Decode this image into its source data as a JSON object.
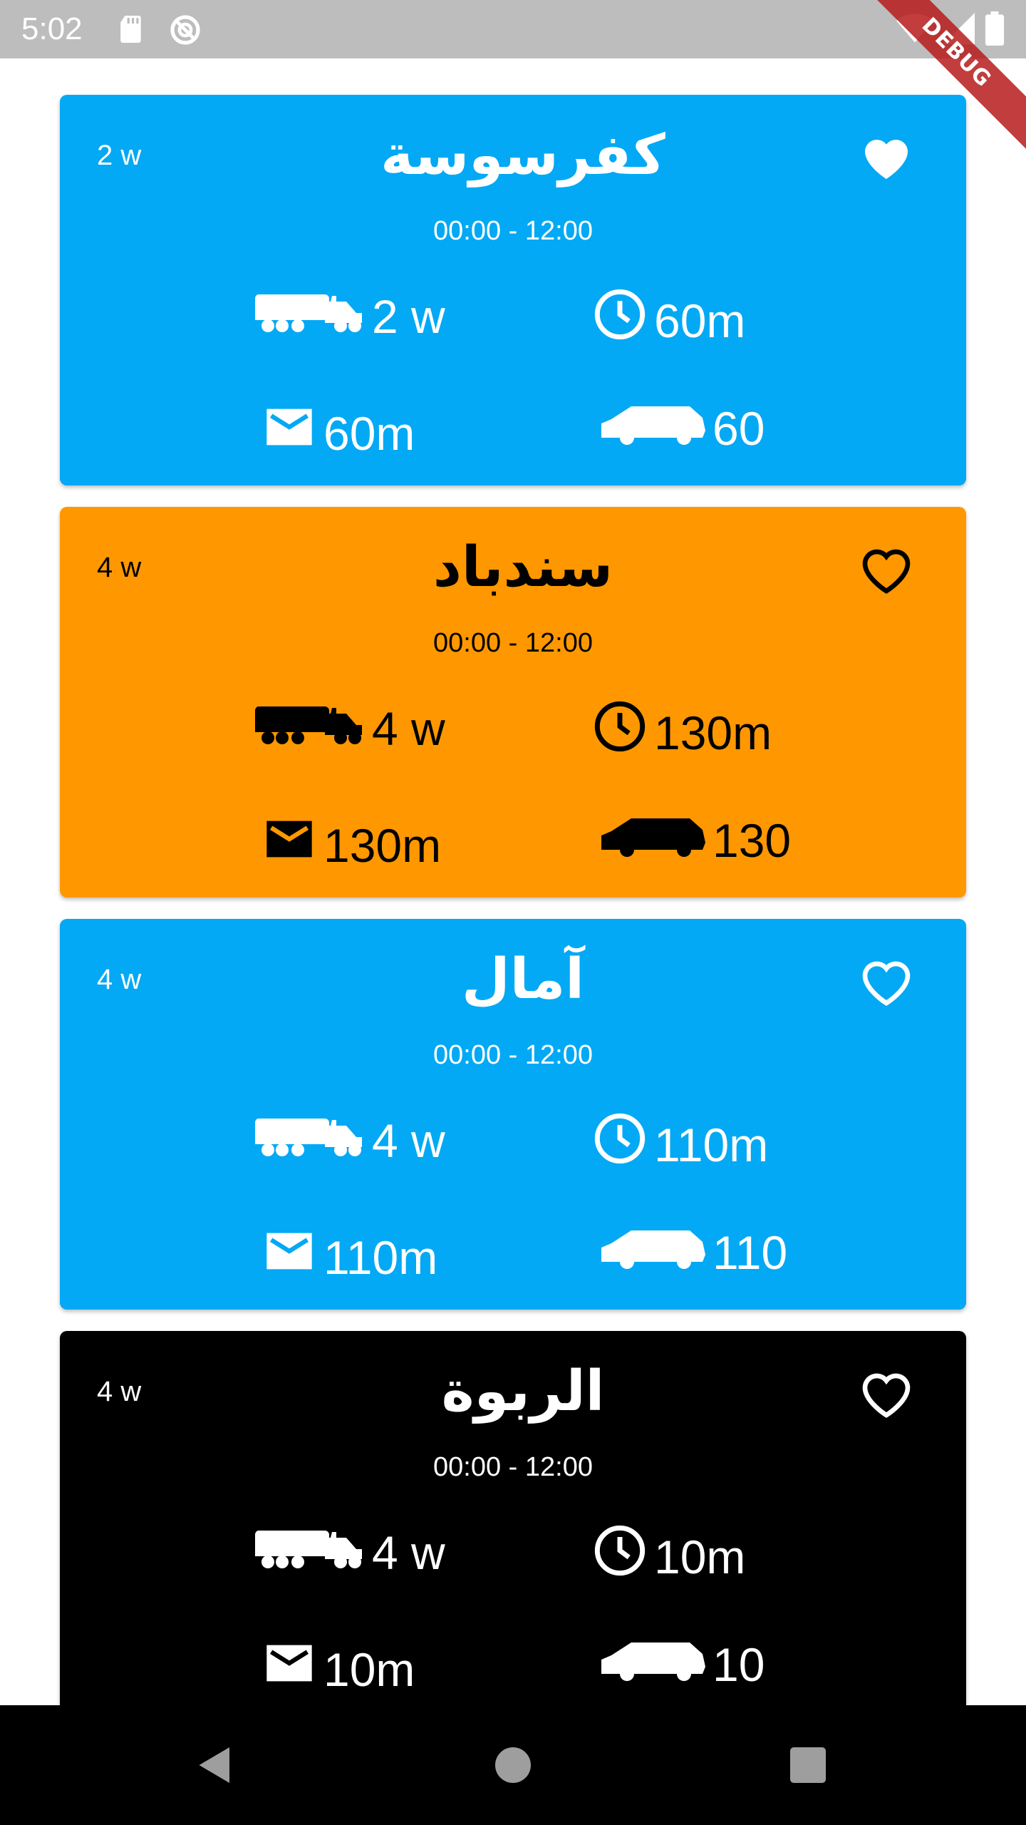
{
  "status_bar": {
    "time": "5:02",
    "icons": [
      "sd-card-icon",
      "sync-icon",
      "wifi-icon",
      "signal-icon",
      "battery-icon"
    ],
    "background": "#bdbdbd"
  },
  "debug_banner": {
    "label": "DEBUG",
    "color": "#b71c1c"
  },
  "cards": [
    {
      "badge": "2 w",
      "title": "كفرسوسة",
      "hours": "00:00 - 12:00",
      "truck_value": "2 w",
      "clock_value": "60m",
      "mail_value": "60m",
      "car_value": "60",
      "favorite": true,
      "background": "#03a9f4",
      "foreground": "#ffffff"
    },
    {
      "badge": "4 w",
      "title": "سندباد",
      "hours": "00:00 - 12:00",
      "truck_value": "4 w",
      "clock_value": "130m",
      "mail_value": "130m",
      "car_value": "130",
      "favorite": false,
      "background": "#ff9800",
      "foreground": "#000000"
    },
    {
      "badge": "4 w",
      "title": "آمال",
      "hours": "00:00 - 12:00",
      "truck_value": "4 w",
      "clock_value": "110m",
      "mail_value": "110m",
      "car_value": "110",
      "favorite": false,
      "background": "#03a9f4",
      "foreground": "#ffffff"
    },
    {
      "badge": "4 w",
      "title": "الربوة",
      "hours": "00:00 - 12:00",
      "truck_value": "4 w",
      "clock_value": "10m",
      "mail_value": "10m",
      "car_value": "10",
      "favorite": false,
      "background": "#000000",
      "foreground": "#ffffff"
    }
  ],
  "nav_bar": {
    "buttons": [
      "back-icon",
      "home-icon",
      "recents-icon"
    ],
    "background": "#000000"
  }
}
